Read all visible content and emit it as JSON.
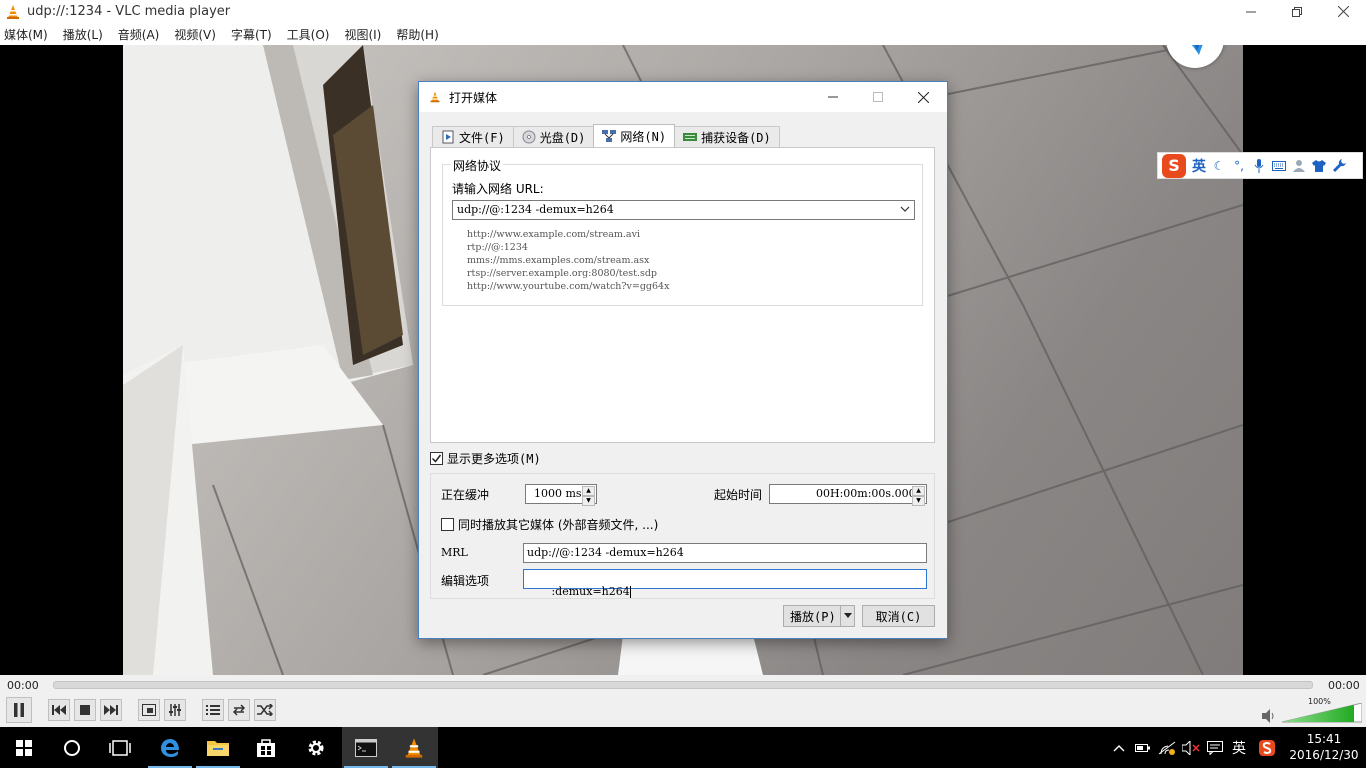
{
  "window": {
    "title": "udp://:1234 - VLC media player"
  },
  "menu": [
    "媒体(M)",
    "播放(L)",
    "音频(A)",
    "视频(V)",
    "字幕(T)",
    "工具(O)",
    "视图(I)",
    "帮助(H)"
  ],
  "ime": {
    "lang": "英"
  },
  "dialog": {
    "title": "打开媒体",
    "tabs": [
      "文件(F)",
      "光盘(D)",
      "网络(N)",
      "捕获设备(D)"
    ],
    "active_tab": "网络(N)",
    "protocol_group": "网络协议",
    "url_label": "请输入网络 URL:",
    "url_value": "udp://@:1234 -demux=h264",
    "examples": [
      "http://www.example.com/stream.avi",
      "rtp://@:1234",
      "mms://mms.examples.com/stream.asx",
      "rtsp://server.example.org:8080/test.sdp",
      "http://www.yourtube.com/watch?v=gg64x"
    ],
    "more_options": "显示更多选项(M)",
    "more_options_checked": true,
    "caching_label": "正在缓冲",
    "caching_value": "1000 ms",
    "start_time_label": "起始时间",
    "start_time_value": "00H:00m:00s.000",
    "sync_label": "同时播放其它媒体 (外部音频文件, ...)",
    "sync_checked": false,
    "mrl_label": "MRL",
    "mrl_value": "udp://@:1234 -demux=h264",
    "edit_label": "编辑选项",
    "edit_value": " :demux=h264",
    "play_button": "播放(P)",
    "cancel_button": "取消(C)"
  },
  "player": {
    "elapsed": "00:00",
    "total": "00:00",
    "progress": 0,
    "volume_label": "100%",
    "volume_level": 1.0
  },
  "taskbar": {
    "time": "15:41",
    "date": "2016/12/30",
    "ime_lang": "英"
  },
  "colors": {
    "dialog_border": "#4a7fc1",
    "vlc_orange": "#f08c00",
    "volume_green": "#3cc33c",
    "focus_blue": "#2f77d1"
  }
}
